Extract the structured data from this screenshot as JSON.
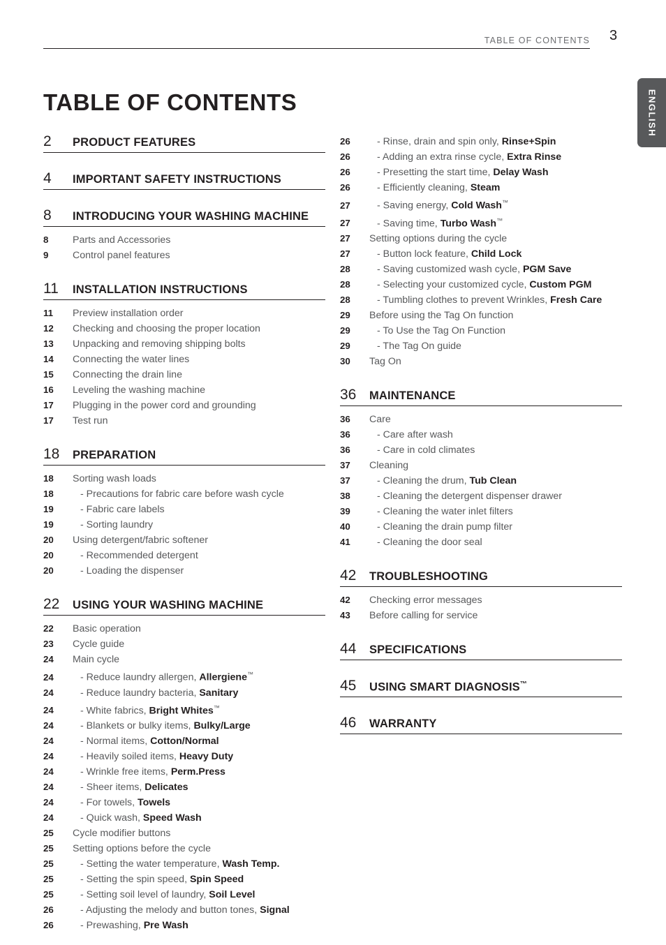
{
  "header": {
    "label": "TABLE OF CONTENTS",
    "page_number": "3"
  },
  "language_tab": {
    "label": "ENGLISH"
  },
  "title": "TABLE OF CONTENTS",
  "columns": {
    "left": [
      {
        "number": "2",
        "title": "PRODUCT FEATURES",
        "entries": []
      },
      {
        "number": "4",
        "title": "IMPORTANT SAFETY INSTRUCTIONS",
        "entries": []
      },
      {
        "number": "8",
        "title": "INTRODUCING YOUR WASHING MACHINE",
        "entries": [
          {
            "num": "8",
            "text": "Parts and Accessories",
            "sub": false
          },
          {
            "num": "9",
            "text": "Control panel features",
            "sub": false
          }
        ]
      },
      {
        "number": "11",
        "title": "INSTALLATION INSTRUCTIONS",
        "entries": [
          {
            "num": "11",
            "text": "Preview installation order",
            "sub": false
          },
          {
            "num": "12",
            "text": "Checking and choosing the proper location",
            "sub": false
          },
          {
            "num": "13",
            "text": "Unpacking and removing shipping bolts",
            "sub": false
          },
          {
            "num": "14",
            "text": "Connecting the water lines",
            "sub": false
          },
          {
            "num": "15",
            "text": "Connecting the drain line",
            "sub": false
          },
          {
            "num": "16",
            "text": "Leveling the washing machine",
            "sub": false
          },
          {
            "num": "17",
            "text": "Plugging in the power cord and grounding",
            "sub": false
          },
          {
            "num": "17",
            "text": "Test run",
            "sub": false
          }
        ]
      },
      {
        "number": "18",
        "title": "PREPARATION",
        "entries": [
          {
            "num": "18",
            "text": "Sorting wash loads",
            "sub": false
          },
          {
            "num": "18",
            "text": "- Precautions for fabric care before wash cycle",
            "sub": true
          },
          {
            "num": "19",
            "text": "- Fabric care labels",
            "sub": true
          },
          {
            "num": "19",
            "text": "- Sorting laundry",
            "sub": true
          },
          {
            "num": "20",
            "text": "Using detergent/fabric softener",
            "sub": false
          },
          {
            "num": "20",
            "text": "- Recommended detergent",
            "sub": true
          },
          {
            "num": "20",
            "text": "- Loading the dispenser",
            "sub": true
          }
        ]
      },
      {
        "number": "22",
        "title": "USING YOUR WASHING MACHINE",
        "entries": [
          {
            "num": "22",
            "text": "Basic operation",
            "sub": false
          },
          {
            "num": "23",
            "text": "Cycle guide",
            "sub": false
          },
          {
            "num": "24",
            "text": "Main cycle",
            "sub": false
          },
          {
            "num": "24",
            "text": "- Reduce laundry allergen, ",
            "bold": "Allergiene",
            "tm": true,
            "sub": true
          },
          {
            "num": "24",
            "text": "- Reduce laundry bacteria, ",
            "bold": "Sanitary",
            "sub": true
          },
          {
            "num": "24",
            "text": "- White fabrics, ",
            "bold": "Bright Whites",
            "tm": true,
            "sub": true
          },
          {
            "num": "24",
            "text": "- Blankets or bulky items, ",
            "bold": "Bulky/Large",
            "sub": true
          },
          {
            "num": "24",
            "text": "- Normal items, ",
            "bold": "Cotton/Normal",
            "sub": true
          },
          {
            "num": "24",
            "text": "- Heavily soiled items, ",
            "bold": "Heavy Duty",
            "sub": true
          },
          {
            "num": "24",
            "text": "- Wrinkle free items, ",
            "bold": "Perm.Press",
            "sub": true
          },
          {
            "num": "24",
            "text": "- Sheer items, ",
            "bold": "Delicates",
            "sub": true
          },
          {
            "num": "24",
            "text": "- For towels, ",
            "bold": "Towels",
            "sub": true
          },
          {
            "num": "24",
            "text": "- Quick wash, ",
            "bold": "Speed Wash",
            "sub": true
          },
          {
            "num": "25",
            "text": "Cycle modifier buttons",
            "sub": false
          },
          {
            "num": "25",
            "text": "Setting options before the cycle",
            "sub": false
          },
          {
            "num": "25",
            "text": "- Setting the water temperature, ",
            "bold": "Wash Temp.",
            "sub": true
          },
          {
            "num": "25",
            "text": "- Setting the spin speed, ",
            "bold": "Spin Speed",
            "sub": true
          },
          {
            "num": "25",
            "text": "- Setting soil level of laundry, ",
            "bold": "Soil Level",
            "sub": true
          },
          {
            "num": "26",
            "text": "- Adjusting the melody and button tones, ",
            "bold": "Signal",
            "sub": true
          },
          {
            "num": "26",
            "text": "- Prewashing, ",
            "bold": "Pre Wash",
            "sub": true
          }
        ]
      }
    ],
    "right": [
      {
        "number": "",
        "title": "",
        "continuation": true,
        "entries": [
          {
            "num": "26",
            "text": "- Rinse, drain and spin only, ",
            "bold": "Rinse+Spin",
            "sub": true
          },
          {
            "num": "26",
            "text": "- Adding an extra rinse cycle, ",
            "bold": "Extra Rinse",
            "sub": true
          },
          {
            "num": "26",
            "text": "- Presetting the start time, ",
            "bold": "Delay Wash",
            "sub": true
          },
          {
            "num": "26",
            "text": "- Efficiently cleaning, ",
            "bold": "Steam",
            "sub": true
          },
          {
            "num": "27",
            "text": "- Saving energy, ",
            "bold": "Cold Wash",
            "tm": true,
            "sub": true
          },
          {
            "num": "27",
            "text": "- Saving time, ",
            "bold": "Turbo Wash",
            "tm": true,
            "sub": true
          },
          {
            "num": "27",
            "text": "Setting options during the cycle",
            "sub": false
          },
          {
            "num": "27",
            "text": "- Button lock feature, ",
            "bold": "Child Lock",
            "sub": true
          },
          {
            "num": "28",
            "text": "- Saving customized wash cycle, ",
            "bold": "PGM Save",
            "sub": true
          },
          {
            "num": "28",
            "text": "- Selecting your customized cycle, ",
            "bold": "Custom PGM",
            "sub": true
          },
          {
            "num": "28",
            "text": "- Tumbling clothes to prevent Wrinkles, ",
            "bold": "Fresh Care",
            "sub": true
          },
          {
            "num": "29",
            "text": "Before using the Tag On function",
            "sub": false
          },
          {
            "num": "29",
            "text": "- To Use the Tag On Function",
            "sub": true
          },
          {
            "num": "29",
            "text": "- The Tag On guide",
            "sub": true
          },
          {
            "num": "30",
            "text": "Tag On",
            "sub": false
          }
        ]
      },
      {
        "number": "36",
        "title": "MAINTENANCE",
        "entries": [
          {
            "num": "36",
            "text": "Care",
            "sub": false
          },
          {
            "num": "36",
            "text": "- Care after wash",
            "sub": true
          },
          {
            "num": "36",
            "text": "- Care in cold climates",
            "sub": true
          },
          {
            "num": "37",
            "text": "Cleaning",
            "sub": false
          },
          {
            "num": "37",
            "text": "- Cleaning the drum, ",
            "bold": "Tub Clean",
            "sub": true
          },
          {
            "num": "38",
            "text": "- Cleaning the detergent dispenser drawer",
            "sub": true
          },
          {
            "num": "39",
            "text": "- Cleaning the water inlet filters",
            "sub": true
          },
          {
            "num": "40",
            "text": "- Cleaning the drain pump filter",
            "sub": true
          },
          {
            "num": "41",
            "text": "- Cleaning the door seal",
            "sub": true
          }
        ]
      },
      {
        "number": "42",
        "title": "TROUBLESHOOTING",
        "entries": [
          {
            "num": "42",
            "text": "Checking error messages",
            "sub": false
          },
          {
            "num": "43",
            "text": "Before calling for service",
            "sub": false
          }
        ]
      },
      {
        "number": "44",
        "title": "SPECIFICATIONS",
        "entries": []
      },
      {
        "number": "45",
        "title": "USING SMART DIAGNOSIS",
        "tm": true,
        "entries": []
      },
      {
        "number": "46",
        "title": "WARRANTY",
        "entries": []
      }
    ]
  },
  "colors": {
    "ink": "#231f20",
    "body_gray": "#58595b",
    "header_gray": "#6d6e71",
    "tab_bg": "#58595b"
  }
}
